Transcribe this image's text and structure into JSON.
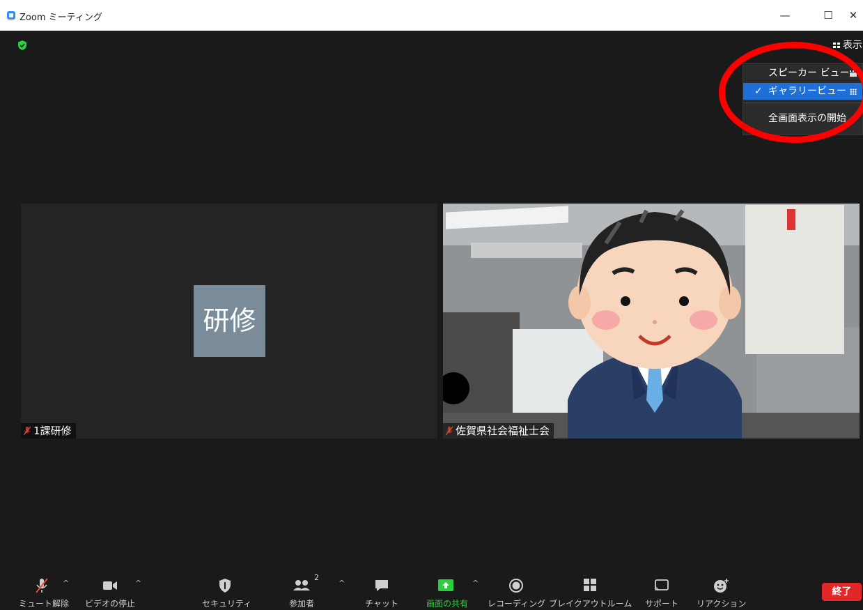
{
  "window": {
    "title": "Zoom ミーティング",
    "controls": {
      "minimize": "—",
      "maximize": "☐",
      "close": "✕"
    }
  },
  "header": {
    "view_label": "表示",
    "security_icon": "shield-check-icon"
  },
  "view_menu": {
    "items": [
      {
        "label": "スピーカー ビュー",
        "checked": false,
        "icon": "speaker-view-icon"
      },
      {
        "label": "ギャラリービュー",
        "checked": true,
        "check_mark": "✓",
        "icon": "gallery-view-icon"
      },
      {
        "label": "全画面表示の開始",
        "checked": false
      }
    ],
    "highlight_color": "#1e6fd8",
    "annotation_color": "#ff0000"
  },
  "tiles": [
    {
      "avatar_text": "研修",
      "name": "1課研修",
      "muted": true,
      "avatar_color": "#7a8b99"
    },
    {
      "name": "佐賀県社会福祉士会",
      "muted": true
    }
  ],
  "toolbar": {
    "items": [
      {
        "label": "ミュート解除",
        "icon": "mic-muted-icon",
        "caret": "^"
      },
      {
        "label": "ビデオの停止",
        "icon": "video-camera-icon",
        "caret": "^"
      },
      {
        "label": "セキュリティ",
        "icon": "shield-icon"
      },
      {
        "label": "参加者",
        "icon": "participants-icon",
        "count": "2",
        "caret": "^"
      },
      {
        "label": "チャット",
        "icon": "chat-icon"
      },
      {
        "label": "画面の共有",
        "icon": "share-screen-icon",
        "caret": "^",
        "accent": "#2ecc40"
      },
      {
        "label": "レコーディング",
        "icon": "record-icon"
      },
      {
        "label": "ブレイクアウトルーム",
        "icon": "breakout-rooms-icon"
      },
      {
        "label": "サポート",
        "icon": "support-cast-icon"
      },
      {
        "label": "リアクション",
        "icon": "reaction-emoji-icon"
      }
    ],
    "end_label": "終了",
    "end_color": "#e02828"
  }
}
